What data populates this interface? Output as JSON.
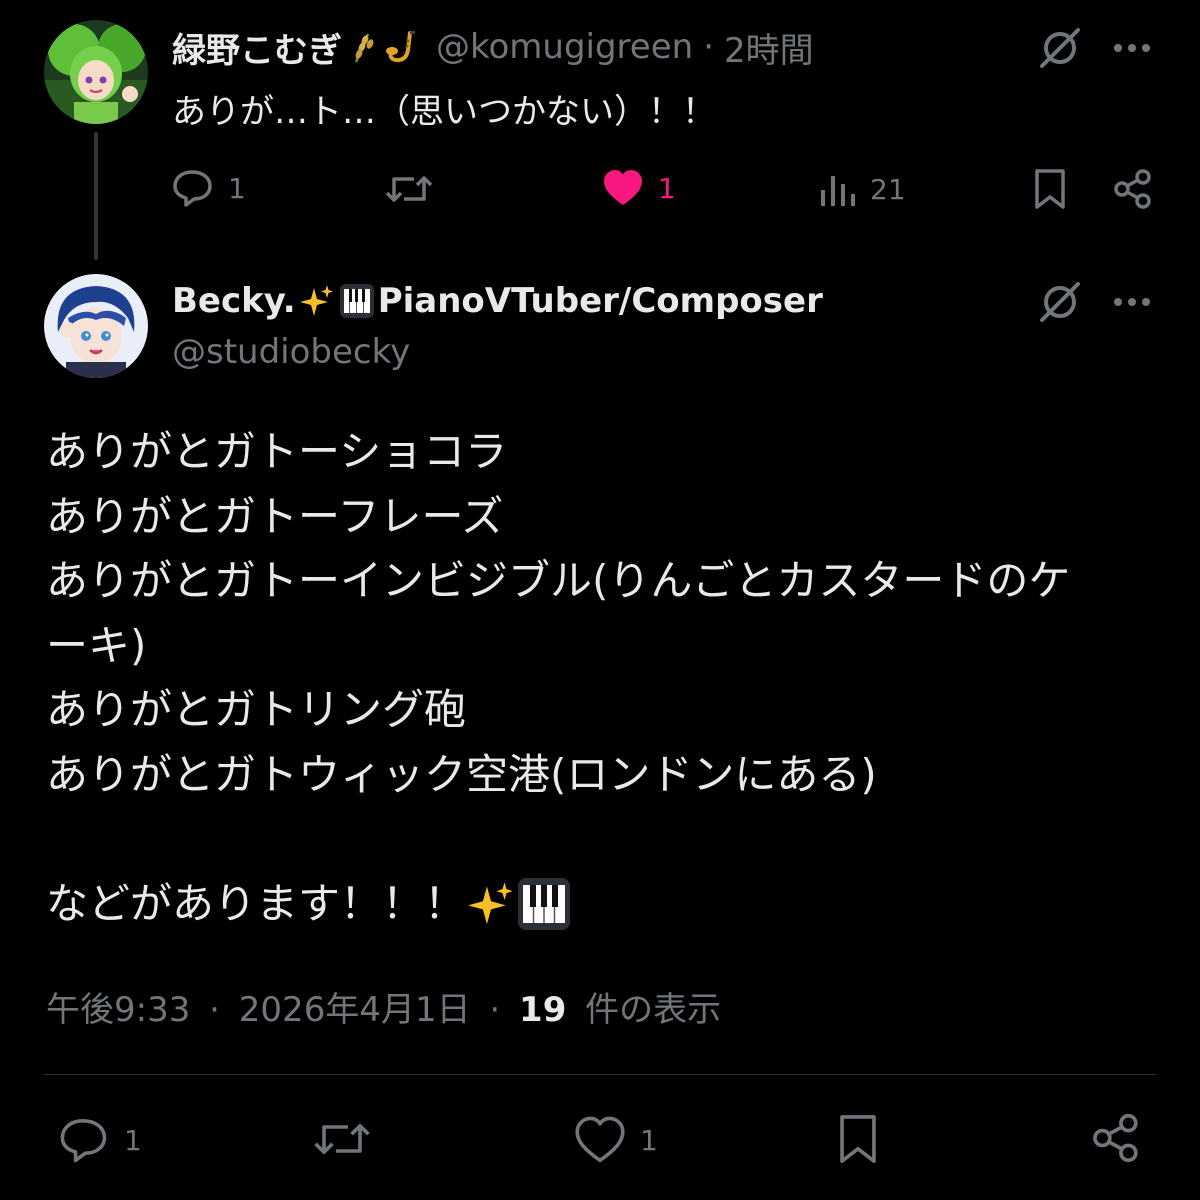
{
  "reply": {
    "display_name": "緑野こむぎ",
    "handle": "@komugigreen",
    "separator": "·",
    "time": "2時間",
    "text": "ありが…ト…（思いつかない）！！",
    "actions": {
      "replies": "1",
      "likes": "1",
      "views": "21"
    },
    "emojis": [
      "wheat-icon",
      "saxophone-icon"
    ]
  },
  "tweet": {
    "display_name": "Becky.",
    "display_name_rest": "PianoVTuber/Composer",
    "handle": "@studiobecky",
    "lines": [
      "ありがとガトーショコラ",
      "ありがとガトーフレーズ",
      "ありがとガトーインビジブル(りんごとカスタードのケ",
      "ーキ)",
      "ありがとガトリング砲",
      "ありがとガトウィック空港(ロンドンにある)",
      "",
      "などがあります！！！"
    ],
    "meta": {
      "time": "午後9:33",
      "sep1": "·",
      "date": "2026年4月1日",
      "sep2": "·",
      "views_count": "19",
      "views_label": "件の表示"
    },
    "actions": {
      "replies": "1",
      "likes": "1"
    }
  },
  "colors": {
    "background": "#000000",
    "text": "#e7e9ea",
    "muted": "#71767b",
    "like_active": "#f91880",
    "divider": "#2f3336"
  }
}
